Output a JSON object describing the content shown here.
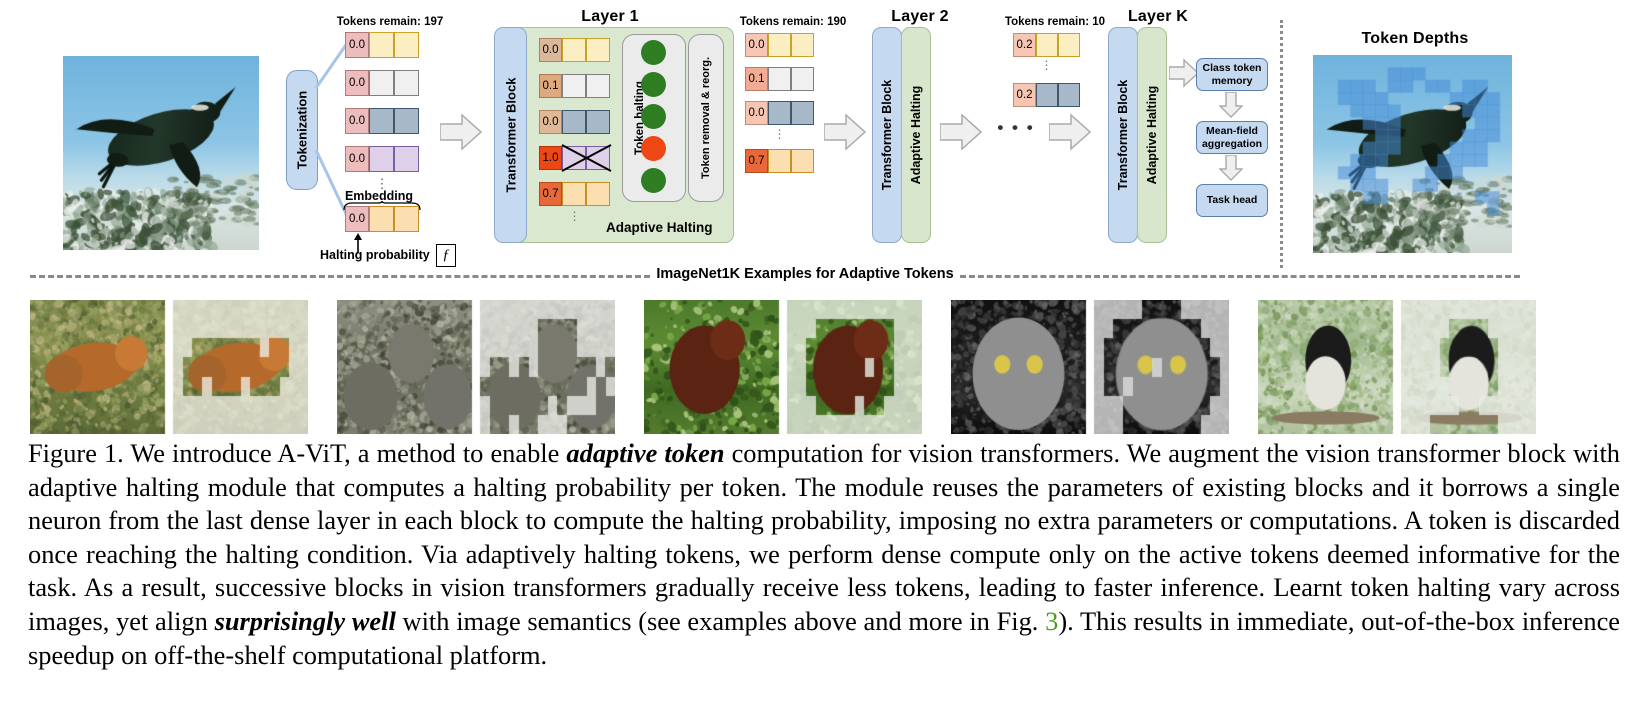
{
  "figure": {
    "id": "figure-1",
    "divider_label": "ImageNet1K Examples for Adaptive Tokens"
  },
  "pipeline": {
    "tokenization_label": "Tokenization",
    "embedding_label": "Embedding",
    "halting_probability_label": "Halting probability",
    "halting_fn_glyph": "ƒ",
    "token_depths_title": "Token Depths"
  },
  "stages": [
    {
      "key": "input",
      "tokens_remain_label": "Tokens remain: 197",
      "tokens_remain_count": 197,
      "token_rows": [
        {
          "halting": "0.0",
          "halt_color": "#edbdbd",
          "body_color": "#fbeec3",
          "body_border": "#c9a227"
        },
        {
          "halting": "0.0",
          "halt_color": "#edbdbd",
          "body_color": "#f0f0f0",
          "body_border": "#808080"
        },
        {
          "halting": "0.0",
          "halt_color": "#edbdbd",
          "body_color": "#a7b9c9",
          "body_border": "#3f576b"
        },
        {
          "halting": "0.0",
          "halt_color": "#edbdbd",
          "body_color": "#ddd0e8",
          "body_border": "#7b5ea0"
        },
        {
          "halting": "0.0",
          "halt_color": "#edbdbd",
          "body_color": "#fbdfb0",
          "body_border": "#c98f27"
        }
      ],
      "ellipsis": "⋮"
    },
    {
      "key": "layer1",
      "title": "Layer 1",
      "transformer_block_label": "Transformer  Block",
      "adaptive_halting_label": "Adaptive Halting",
      "token_halting_label": "Token halting",
      "token_removal_label": "Token removal & reorg.",
      "token_rows": [
        {
          "halting": "0.0",
          "halt_color": "#dcb89a",
          "body_color": "#fbeec3",
          "body_border": "#c9a227",
          "crossed": false,
          "dot": "green"
        },
        {
          "halting": "0.1",
          "halt_color": "#dfa97f",
          "body_color": "#f0f0f0",
          "body_border": "#808080",
          "crossed": false,
          "dot": "green"
        },
        {
          "halting": "0.0",
          "halt_color": "#e0b896",
          "body_color": "#a7b9c9",
          "body_border": "#3f576b",
          "crossed": false,
          "dot": "green"
        },
        {
          "halting": "1.0",
          "halt_color": "#ec4714",
          "body_color": "#ddd0e8",
          "body_border": "#7b5ea0",
          "crossed": true,
          "dot": "red"
        },
        {
          "halting": "0.7",
          "halt_color": "#e8683a",
          "body_color": "#fbdfb0",
          "body_border": "#c98f27",
          "crossed": false,
          "dot": "green"
        }
      ],
      "ellipsis": "⋮"
    },
    {
      "key": "after_layer1",
      "tokens_remain_label": "Tokens remain: 190",
      "tokens_remain_count": 190,
      "token_rows": [
        {
          "halting": "0.0",
          "halt_color": "#f6c6b3",
          "body_color": "#fbeec3",
          "body_border": "#c9a227"
        },
        {
          "halting": "0.1",
          "halt_color": "#f2ac94",
          "body_color": "#f0f0f0",
          "body_border": "#808080"
        },
        {
          "halting": "0.0",
          "halt_color": "#f6c6b3",
          "body_color": "#a7b9c9",
          "body_border": "#3f576b"
        },
        {
          "halting": "0.7",
          "halt_color": "#e8683a",
          "body_color": "#fbdfb0",
          "body_border": "#c98f27"
        }
      ],
      "ellipsis": "⋮"
    },
    {
      "key": "layer2",
      "title": "Layer 2",
      "transformer_block_label": "Transformer  Block",
      "adaptive_halting_label": "Adaptive Halting"
    },
    {
      "key": "before_layerk",
      "tokens_remain_label": "Tokens remain: 10",
      "tokens_remain_count": 10,
      "token_rows": [
        {
          "halting": "0.2",
          "halt_color": "#f6c6b3",
          "body_color": "#fbeec3",
          "body_border": "#c9a227"
        },
        {
          "halting": "0.2",
          "halt_color": "#f6c6b3",
          "body_color": "#a7b9c9",
          "body_border": "#3f576b"
        }
      ],
      "ellipsis": "⋮"
    },
    {
      "key": "layerk",
      "title": "Layer K",
      "transformer_block_label": "Transformer  Block",
      "adaptive_halting_label": "Adaptive Halting"
    }
  ],
  "head_flow": [
    {
      "label": "Class token\nmemory",
      "name": "class-token-memory"
    },
    {
      "label": "Mean-field\naggregation",
      "name": "mean-field-aggregation"
    },
    {
      "label": "Task head",
      "name": "task-head"
    }
  ],
  "inter_layer_dots": "•   •   •",
  "examples": [
    {
      "name": "fox",
      "original_alt": "Red fox leaping over grass",
      "tokens_alt": "Fox with adaptive token patches"
    },
    {
      "name": "boar",
      "original_alt": "Wild boars on forest path",
      "tokens_alt": "Boars with adaptive token patches"
    },
    {
      "name": "orangutan",
      "original_alt": "Orangutan in tree",
      "tokens_alt": "Orangutan with adaptive token patches"
    },
    {
      "name": "owl",
      "original_alt": "Great grey owl face",
      "tokens_alt": "Owl with adaptive token patches"
    },
    {
      "name": "chickadee",
      "original_alt": "Chickadee on branch",
      "tokens_alt": "Chickadee with adaptive token patches"
    }
  ],
  "caption": {
    "label": "Figure 1.",
    "segments": [
      {
        "text": "Figure 1.  We introduce A-ViT, a method to enable ",
        "style": "normal"
      },
      {
        "text": "adaptive token",
        "style": "bold-italic"
      },
      {
        "text": " computation for vision transformers. We augment the vision transformer block with adaptive halting module that computes a halting probability per token. The module reuses the parameters of existing blocks and it borrows a single neuron from the last dense layer in each block to compute the halting probability, imposing no extra parameters or computations. A token is discarded once reaching the halting condition. Via adaptively halting tokens, we perform dense compute only on the active tokens deemed informative for the task. As a result, successive blocks in vision transformers gradually receive less tokens, leading to faster inference. Learnt token halting vary across images, yet align ",
        "style": "normal"
      },
      {
        "text": "surprisingly well",
        "style": "bold-italic"
      },
      {
        "text": " with image semantics (see examples above and more in Fig. ",
        "style": "normal"
      },
      {
        "text": "3",
        "style": "green-ref"
      },
      {
        "text": "). This results in immediate, out-of-the-box inference speedup on off-the-shelf computational platform.",
        "style": "normal"
      }
    ]
  },
  "colors": {
    "transformer_block": "#c5d9f1",
    "adaptive_halting": "#d8e6cd",
    "halt_red": "#ec4714",
    "dot_green": "#2e7d23",
    "dot_red": "#ec4714",
    "green_ref": "#4d9b1d",
    "arrow_fill": "#efefef",
    "arrow_stroke": "#aaaaaa"
  }
}
